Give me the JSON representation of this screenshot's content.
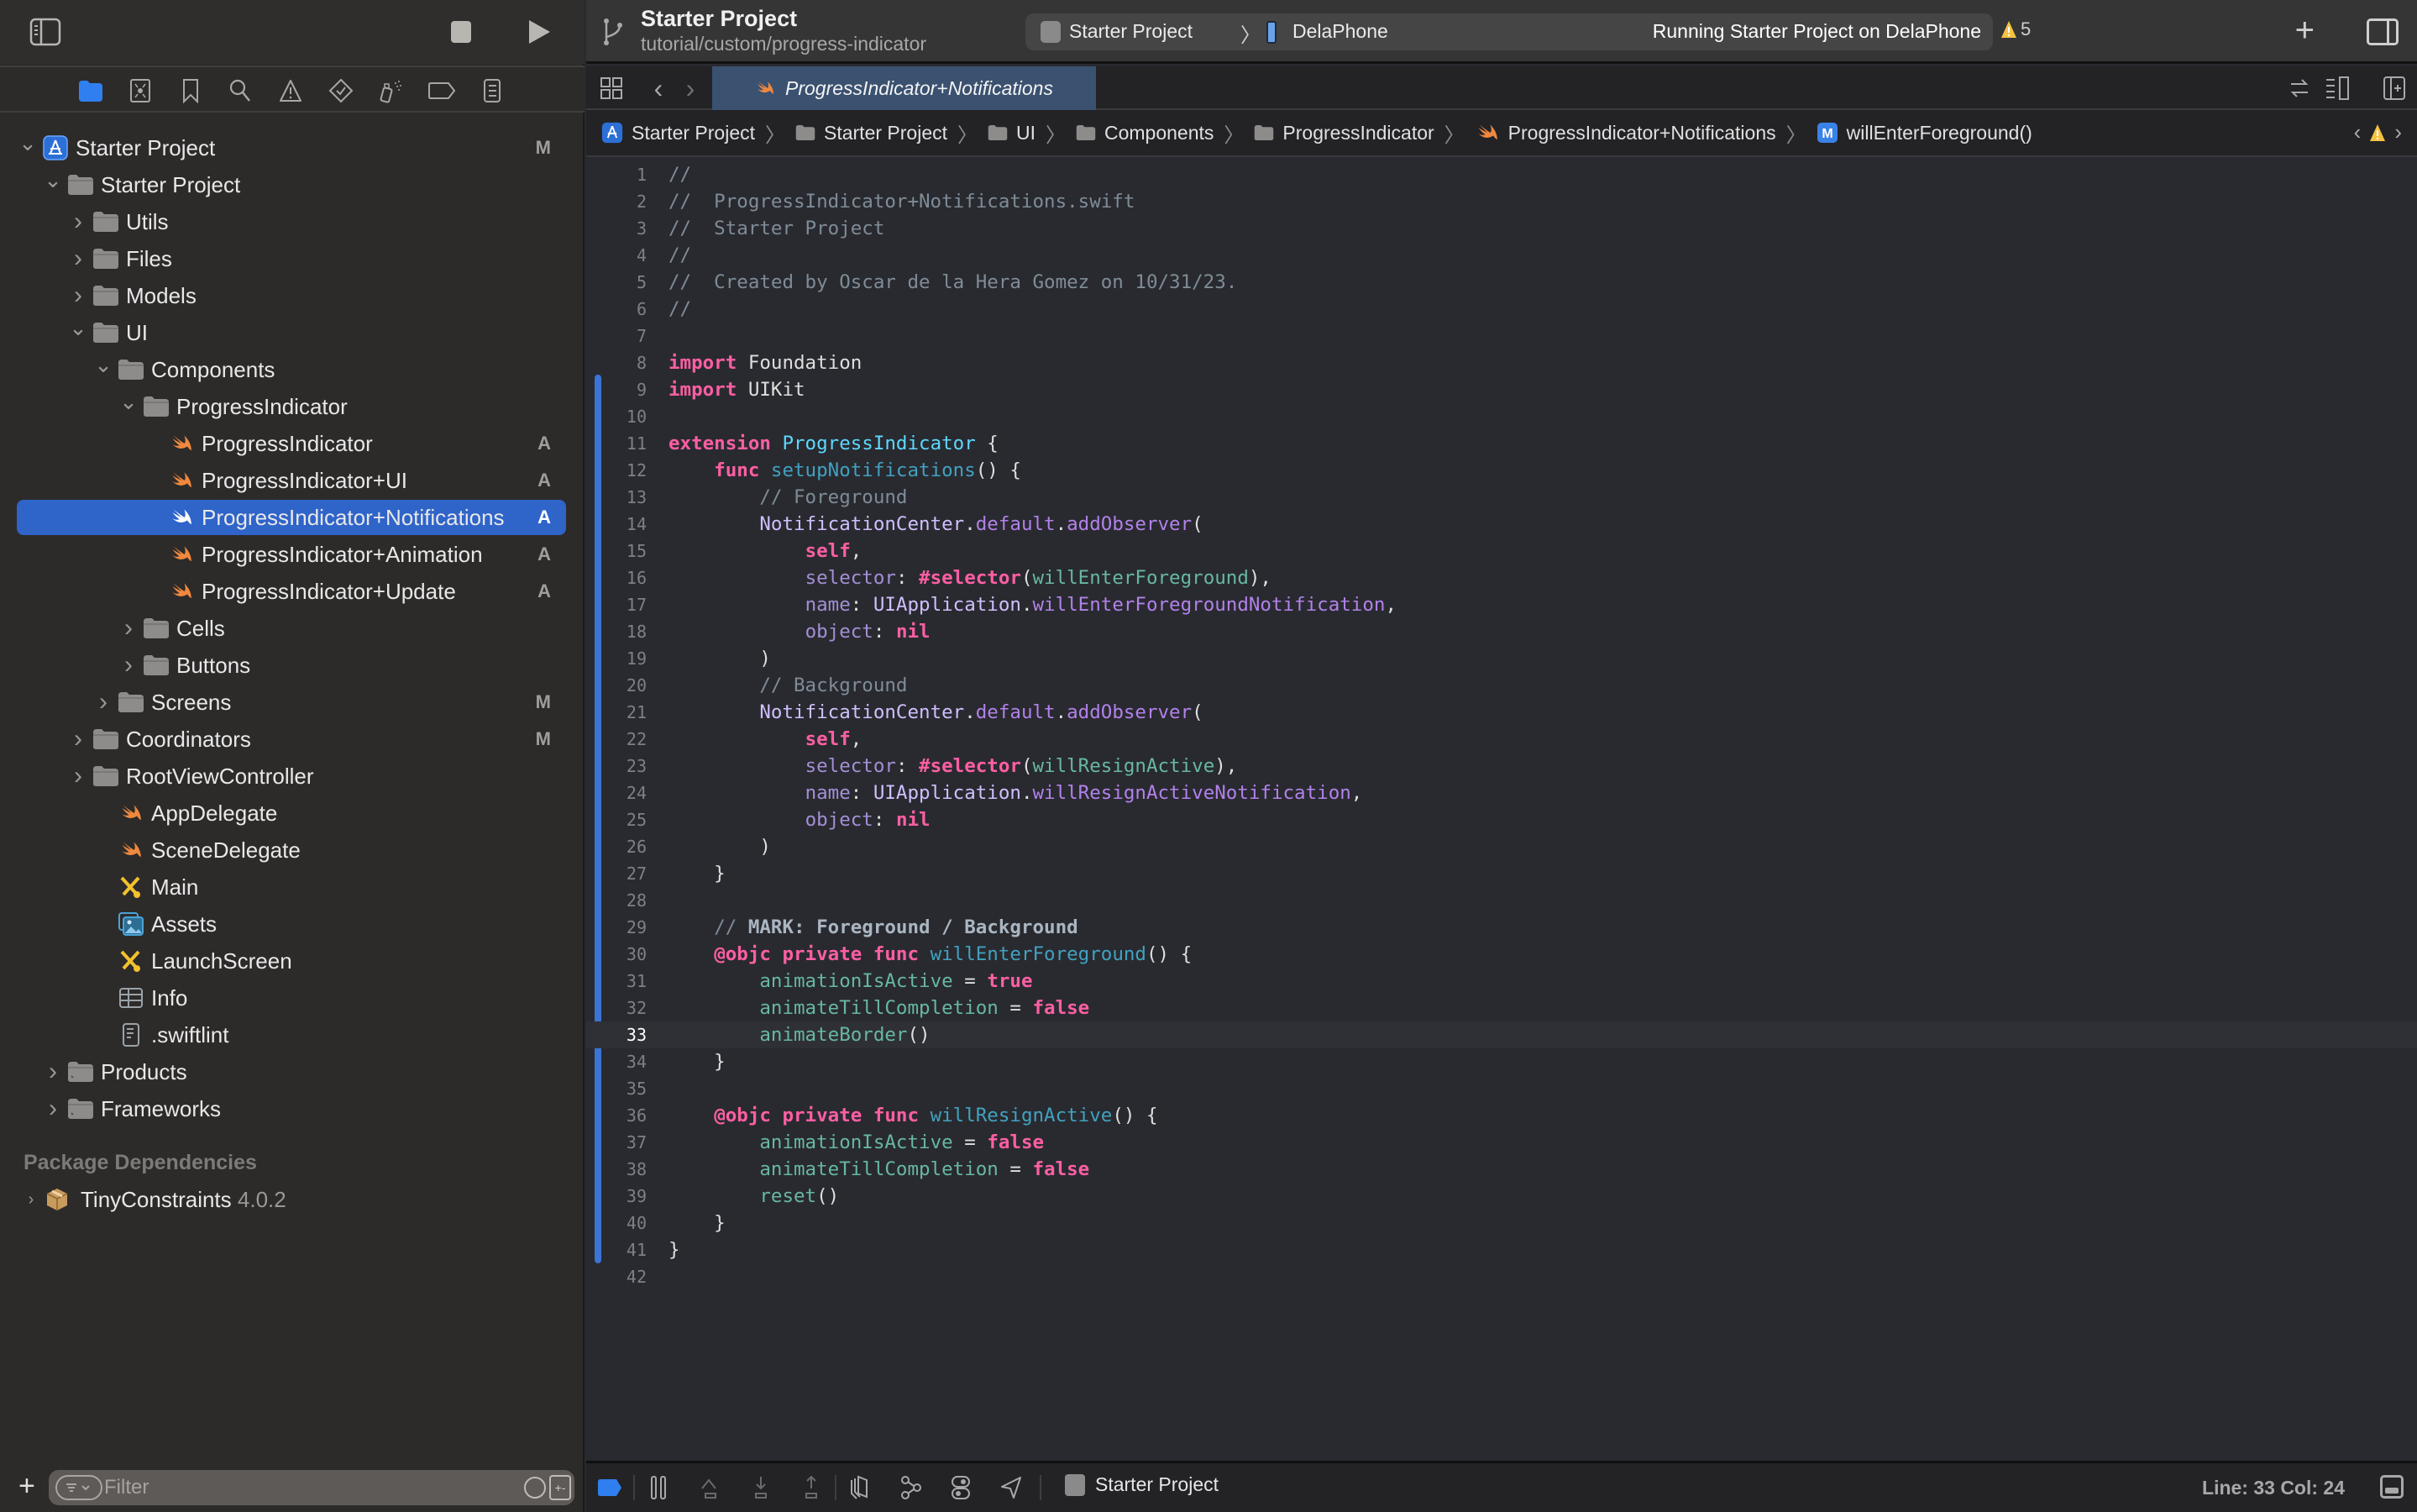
{
  "window": {
    "project_title": "Starter Project",
    "branch": "tutorial/custom/progress-indicator",
    "scheme": "Starter Project",
    "device": "DelaPhone",
    "run_status": "Running Starter Project on DelaPhone",
    "warning_count": "5"
  },
  "sidebar": {
    "nav_tabs": [
      "project-navigator",
      "source-control-navigator",
      "bookmark-navigator",
      "find-navigator",
      "issue-navigator",
      "test-navigator",
      "debug-navigator",
      "breakpoint-navigator",
      "report-navigator"
    ],
    "tree": [
      {
        "label": "Starter Project",
        "kind": "project",
        "depth": 0,
        "chevron": "down",
        "badge": "M"
      },
      {
        "label": "Starter Project",
        "kind": "folder",
        "depth": 1,
        "chevron": "down",
        "badge": ""
      },
      {
        "label": "Utils",
        "kind": "folder",
        "depth": 2,
        "chevron": "right",
        "badge": ""
      },
      {
        "label": "Files",
        "kind": "folder",
        "depth": 2,
        "chevron": "right",
        "badge": ""
      },
      {
        "label": "Models",
        "kind": "folder",
        "depth": 2,
        "chevron": "right",
        "badge": ""
      },
      {
        "label": "UI",
        "kind": "folder",
        "depth": 2,
        "chevron": "down",
        "badge": ""
      },
      {
        "label": "Components",
        "kind": "folder",
        "depth": 3,
        "chevron": "down",
        "badge": ""
      },
      {
        "label": "ProgressIndicator",
        "kind": "folder",
        "depth": 4,
        "chevron": "down",
        "badge": ""
      },
      {
        "label": "ProgressIndicator",
        "kind": "swift",
        "depth": 5,
        "chevron": "",
        "badge": "A"
      },
      {
        "label": "ProgressIndicator+UI",
        "kind": "swift",
        "depth": 5,
        "chevron": "",
        "badge": "A"
      },
      {
        "label": "ProgressIndicator+Notifications",
        "kind": "swift",
        "depth": 5,
        "chevron": "",
        "badge": "A",
        "selected": true
      },
      {
        "label": "ProgressIndicator+Animation",
        "kind": "swift",
        "depth": 5,
        "chevron": "",
        "badge": "A"
      },
      {
        "label": "ProgressIndicator+Update",
        "kind": "swift",
        "depth": 5,
        "chevron": "",
        "badge": "A"
      },
      {
        "label": "Cells",
        "kind": "folder",
        "depth": 4,
        "chevron": "right",
        "badge": ""
      },
      {
        "label": "Buttons",
        "kind": "folder",
        "depth": 4,
        "chevron": "right",
        "badge": ""
      },
      {
        "label": "Screens",
        "kind": "folder",
        "depth": 3,
        "chevron": "right",
        "badge": "M"
      },
      {
        "label": "Coordinators",
        "kind": "folder",
        "depth": 2,
        "chevron": "right",
        "badge": "M"
      },
      {
        "label": "RootViewController",
        "kind": "folder",
        "depth": 2,
        "chevron": "right",
        "badge": ""
      },
      {
        "label": "AppDelegate",
        "kind": "swift",
        "depth": 3,
        "chevron": "",
        "badge": ""
      },
      {
        "label": "SceneDelegate",
        "kind": "swift",
        "depth": 3,
        "chevron": "",
        "badge": ""
      },
      {
        "label": "Main",
        "kind": "storyboard",
        "depth": 3,
        "chevron": "",
        "badge": ""
      },
      {
        "label": "Assets",
        "kind": "assets",
        "depth": 3,
        "chevron": "",
        "badge": ""
      },
      {
        "label": "LaunchScreen",
        "kind": "storyboard",
        "depth": 3,
        "chevron": "",
        "badge": ""
      },
      {
        "label": "Info",
        "kind": "plist",
        "depth": 3,
        "chevron": "",
        "badge": ""
      },
      {
        "label": ".swiftlint",
        "kind": "text",
        "depth": 3,
        "chevron": "",
        "badge": ""
      },
      {
        "label": "Products",
        "kind": "folder-products",
        "depth": 1,
        "chevron": "right",
        "badge": ""
      },
      {
        "label": "Frameworks",
        "kind": "folder-products",
        "depth": 1,
        "chevron": "right",
        "badge": ""
      }
    ],
    "package_header": "Package Dependencies",
    "package": {
      "name": "TinyConstraints",
      "version": "4.0.2"
    },
    "filter_placeholder": "Filter"
  },
  "editor": {
    "tab_title": "ProgressIndicator+Notifications",
    "breadcrumb": [
      {
        "label": "Starter Project",
        "icon": "project"
      },
      {
        "label": "Starter Project",
        "icon": "folder"
      },
      {
        "label": "UI",
        "icon": "folder"
      },
      {
        "label": "Components",
        "icon": "folder"
      },
      {
        "label": "ProgressIndicator",
        "icon": "folder"
      },
      {
        "label": "ProgressIndicator+Notifications",
        "icon": "swift"
      },
      {
        "label": "willEnterForeground()",
        "icon": "method"
      }
    ],
    "current_line": 33,
    "lines": [
      [
        [
          "cm",
          "//"
        ]
      ],
      [
        [
          "cm",
          "//  ProgressIndicator+Notifications.swift"
        ]
      ],
      [
        [
          "cm",
          "//  Starter Project"
        ]
      ],
      [
        [
          "cm",
          "//"
        ]
      ],
      [
        [
          "cm",
          "//  Created by Oscar de la Hera Gomez on 10/31/23."
        ]
      ],
      [
        [
          "cm",
          "//"
        ]
      ],
      [],
      [
        [
          "kw",
          "import"
        ],
        [
          "pl",
          " Foundation"
        ]
      ],
      [
        [
          "kw",
          "import"
        ],
        [
          "pl",
          " UIKit"
        ]
      ],
      [],
      [
        [
          "kw",
          "extension"
        ],
        [
          "pl",
          " "
        ],
        [
          "ty",
          "ProgressIndicator"
        ],
        [
          "pl",
          " {"
        ]
      ],
      [
        [
          "pl",
          "    "
        ],
        [
          "kw",
          "func"
        ],
        [
          "pl",
          " "
        ],
        [
          "dc",
          "setupNotifications"
        ],
        [
          "pl",
          "() {"
        ]
      ],
      [
        [
          "pl",
          "        "
        ],
        [
          "cm",
          "// Foreground"
        ]
      ],
      [
        [
          "pl",
          "        "
        ],
        [
          "tyu",
          "NotificationCenter"
        ],
        [
          "pl",
          "."
        ],
        [
          "prl",
          "default"
        ],
        [
          "pl",
          "."
        ],
        [
          "prl",
          "addObserver"
        ],
        [
          "pl",
          "("
        ]
      ],
      [
        [
          "pl",
          "            "
        ],
        [
          "kw",
          "self"
        ],
        [
          "pl",
          ","
        ]
      ],
      [
        [
          "pl",
          "            "
        ],
        [
          "ar",
          "selector"
        ],
        [
          "pl",
          ": "
        ],
        [
          "kw",
          "#selector"
        ],
        [
          "pl",
          "("
        ],
        [
          "fn",
          "willEnterForeground"
        ],
        [
          "pl",
          "),"
        ]
      ],
      [
        [
          "pl",
          "            "
        ],
        [
          "ar",
          "name"
        ],
        [
          "pl",
          ": "
        ],
        [
          "tyu",
          "UIApplication"
        ],
        [
          "pl",
          "."
        ],
        [
          "prl",
          "willEnterForegroundNotification"
        ],
        [
          "pl",
          ","
        ]
      ],
      [
        [
          "pl",
          "            "
        ],
        [
          "ar",
          "object"
        ],
        [
          "pl",
          ": "
        ],
        [
          "kw",
          "nil"
        ]
      ],
      [
        [
          "pl",
          "        )"
        ]
      ],
      [
        [
          "pl",
          "        "
        ],
        [
          "cm",
          "// Background"
        ]
      ],
      [
        [
          "pl",
          "        "
        ],
        [
          "tyu",
          "NotificationCenter"
        ],
        [
          "pl",
          "."
        ],
        [
          "prl",
          "default"
        ],
        [
          "pl",
          "."
        ],
        [
          "prl",
          "addObserver"
        ],
        [
          "pl",
          "("
        ]
      ],
      [
        [
          "pl",
          "            "
        ],
        [
          "kw",
          "self"
        ],
        [
          "pl",
          ","
        ]
      ],
      [
        [
          "pl",
          "            "
        ],
        [
          "ar",
          "selector"
        ],
        [
          "pl",
          ": "
        ],
        [
          "kw",
          "#selector"
        ],
        [
          "pl",
          "("
        ],
        [
          "fn",
          "willResignActive"
        ],
        [
          "pl",
          "),"
        ]
      ],
      [
        [
          "pl",
          "            "
        ],
        [
          "ar",
          "name"
        ],
        [
          "pl",
          ": "
        ],
        [
          "tyu",
          "UIApplication"
        ],
        [
          "pl",
          "."
        ],
        [
          "prl",
          "willResignActiveNotification"
        ],
        [
          "pl",
          ","
        ]
      ],
      [
        [
          "pl",
          "            "
        ],
        [
          "ar",
          "object"
        ],
        [
          "pl",
          ": "
        ],
        [
          "kw",
          "nil"
        ]
      ],
      [
        [
          "pl",
          "        )"
        ]
      ],
      [
        [
          "pl",
          "    }"
        ]
      ],
      [],
      [
        [
          "pl",
          "    "
        ],
        [
          "cm",
          "// "
        ],
        [
          "mk",
          "MARK: Foreground / Background"
        ]
      ],
      [
        [
          "pl",
          "    "
        ],
        [
          "kw",
          "@objc private func"
        ],
        [
          "pl",
          " "
        ],
        [
          "dc",
          "willEnterForeground"
        ],
        [
          "pl",
          "() {"
        ]
      ],
      [
        [
          "pl",
          "        "
        ],
        [
          "fn",
          "animationIsActive"
        ],
        [
          "pl",
          " = "
        ],
        [
          "kw",
          "true"
        ]
      ],
      [
        [
          "pl",
          "        "
        ],
        [
          "fn",
          "animateTillCompletion"
        ],
        [
          "pl",
          " = "
        ],
        [
          "kw",
          "false"
        ]
      ],
      [
        [
          "pl",
          "        "
        ],
        [
          "fn",
          "animateBorder"
        ],
        [
          "pl",
          "()"
        ]
      ],
      [
        [
          "pl",
          "    }"
        ]
      ],
      [],
      [
        [
          "pl",
          "    "
        ],
        [
          "kw",
          "@objc private func"
        ],
        [
          "pl",
          " "
        ],
        [
          "dc",
          "willResignActive"
        ],
        [
          "pl",
          "() {"
        ]
      ],
      [
        [
          "pl",
          "        "
        ],
        [
          "fn",
          "animationIsActive"
        ],
        [
          "pl",
          " = "
        ],
        [
          "kw",
          "false"
        ]
      ],
      [
        [
          "pl",
          "        "
        ],
        [
          "fn",
          "animateTillCompletion"
        ],
        [
          "pl",
          " = "
        ],
        [
          "kw",
          "false"
        ]
      ],
      [
        [
          "pl",
          "        "
        ],
        [
          "fn",
          "reset"
        ],
        [
          "pl",
          "()"
        ]
      ],
      [
        [
          "pl",
          "    }"
        ]
      ],
      [
        [
          "pl",
          "}"
        ]
      ],
      []
    ]
  },
  "debugbar": {
    "target": "Starter Project",
    "line_col": "Line: 33  Col: 24"
  },
  "colors": {
    "accent": "#2f64c9",
    "swift_icon": "#f0883e",
    "warning": "#f5c242",
    "keyword": "#fc5fa3",
    "comment": "#7f8c98",
    "project_type": "#5dd8ff"
  }
}
